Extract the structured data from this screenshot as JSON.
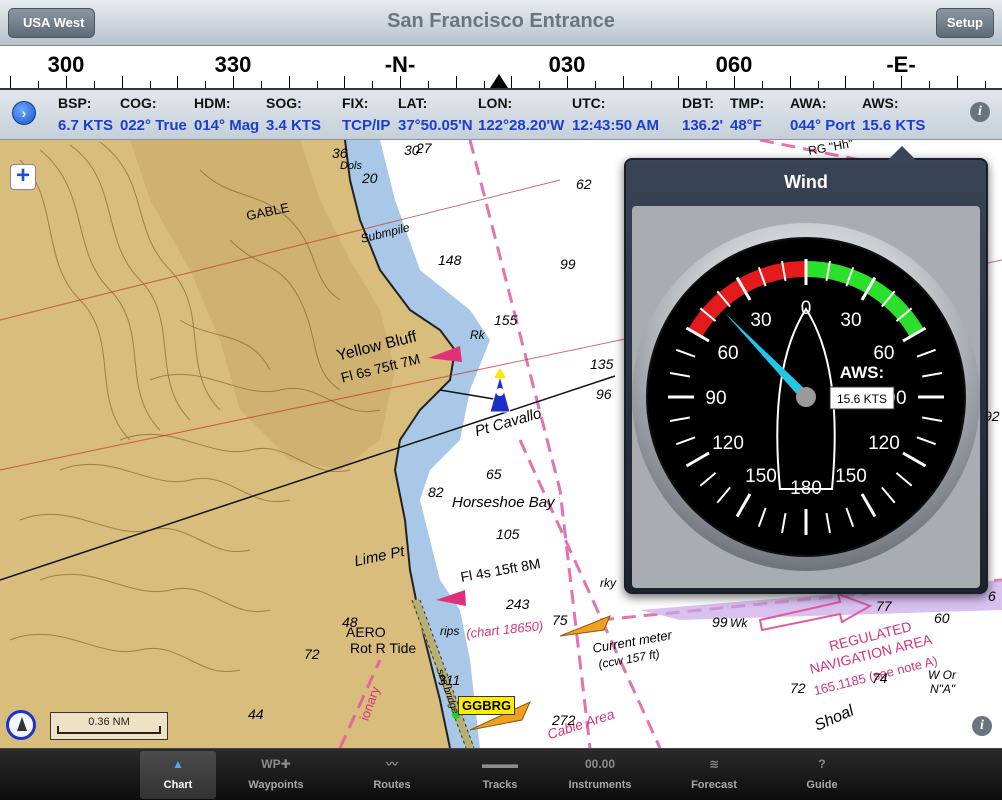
{
  "app": {
    "title": "San Francisco Entrance",
    "back_button": "USA West",
    "setup_button": "Setup"
  },
  "compass": {
    "labels": [
      {
        "text": "300",
        "heading": 300
      },
      {
        "text": "330",
        "heading": 330
      },
      {
        "text": "-N-",
        "heading": 360
      },
      {
        "text": "030",
        "heading": 390
      },
      {
        "text": "060",
        "heading": 420
      },
      {
        "text": "-E-",
        "heading": 450
      }
    ]
  },
  "data_strip": {
    "items": [
      {
        "key": "BSP:",
        "value": "6.7 KTS"
      },
      {
        "key": "COG:",
        "value": "022° True"
      },
      {
        "key": "HDM:",
        "value": "014° Mag"
      },
      {
        "key": "SOG:",
        "value": "3.4 KTS"
      },
      {
        "key": "FIX:",
        "value": "TCP/IP"
      },
      {
        "key": "LAT:",
        "value": "37°50.05'N"
      },
      {
        "key": "LON:",
        "value": "122°28.20'W"
      },
      {
        "key": "UTC:",
        "value": "12:43:50 AM"
      },
      {
        "key": "DBT:",
        "value": "136.2'"
      },
      {
        "key": "TMP:",
        "value": "48°F"
      },
      {
        "key": "AWA:",
        "value": "044° Port"
      },
      {
        "key": "AWS:",
        "value": "15.6 KTS"
      }
    ]
  },
  "chart_map": {
    "labels": {
      "gable": "GABLE",
      "yellow_bluff": "Yellow Bluff",
      "fl_yellow": "Fl 6s 75ft 7M",
      "pt_cavallo": "Pt Cavallo",
      "horseshoe_bay": "Horseshoe Bay",
      "lime_pt": "Lime Pt",
      "fl_lime": "Fl 4s 15ft 8M",
      "aero": "AERO",
      "rot_r_tide": "Rot R Tide",
      "rips": "rips",
      "chart_ref": "(chart 18650)",
      "current_meter": "Current meter",
      "ccw": "(ccw 157 ft)",
      "regulated": "REGULATED",
      "nav_area": "NAVIGATION AREA",
      "nav_area_2": "165.1185 (see note A)",
      "cable_area": "Cable Area",
      "shoal": "Shoal",
      "submarine_pile": "Submpile",
      "rk": "Rk",
      "wk": "Wk",
      "rky": "rky",
      "dols": "Dols",
      "rg": "RG \"Hh\"",
      "wor": "W Or",
      "na": "N\"A\"",
      "pilot": "ionary",
      "bridge": "see bridge"
    },
    "depths": [
      "36",
      "20",
      "30",
      "62",
      "148",
      "99",
      "155",
      "135",
      "96",
      "65",
      "82",
      "105",
      "243",
      "75",
      "99",
      "77",
      "72",
      "44",
      "311",
      "272",
      "72",
      "74",
      "48",
      "27",
      "60",
      "92",
      "6"
    ],
    "waypoint_tag": "GGBRG",
    "scale": "0.36 NM"
  },
  "wind_instrument": {
    "title": "Wind",
    "aws_label": "AWS:",
    "aws_value": "15.6 KTS",
    "apparent_wind_angle_deg": 44,
    "apparent_wind_side": "Port",
    "scale_labels": [
      "0",
      "30",
      "60",
      "90",
      "120",
      "150",
      "180",
      "150",
      "120",
      "90",
      "60",
      "30"
    ]
  },
  "tabs": [
    {
      "label": "Chart",
      "icon": "chart-icon",
      "glyph": "▲",
      "active": true
    },
    {
      "label": "Waypoints",
      "icon": "waypoint-icon",
      "glyph": "WP✚",
      "active": false
    },
    {
      "label": "Routes",
      "icon": "route-icon",
      "glyph": "〰",
      "active": false
    },
    {
      "label": "Tracks",
      "icon": "track-icon",
      "glyph": "▬▬▬",
      "active": false
    },
    {
      "label": "Instruments",
      "icon": "instruments-icon",
      "glyph": "00.00",
      "active": false
    },
    {
      "label": "Forecast",
      "icon": "forecast-icon",
      "glyph": "≋",
      "active": false
    },
    {
      "label": "Guide",
      "icon": "guide-icon",
      "glyph": "?",
      "active": false
    }
  ],
  "colors": {
    "accent_blue": "#1a3fd0",
    "land": "#d9bd7c",
    "shallow_water": "#a9c8e8",
    "magenta": "#d6337d",
    "port_red": "#e41b1b",
    "starboard_green": "#2be02b",
    "pointer": "#22c7e8"
  }
}
